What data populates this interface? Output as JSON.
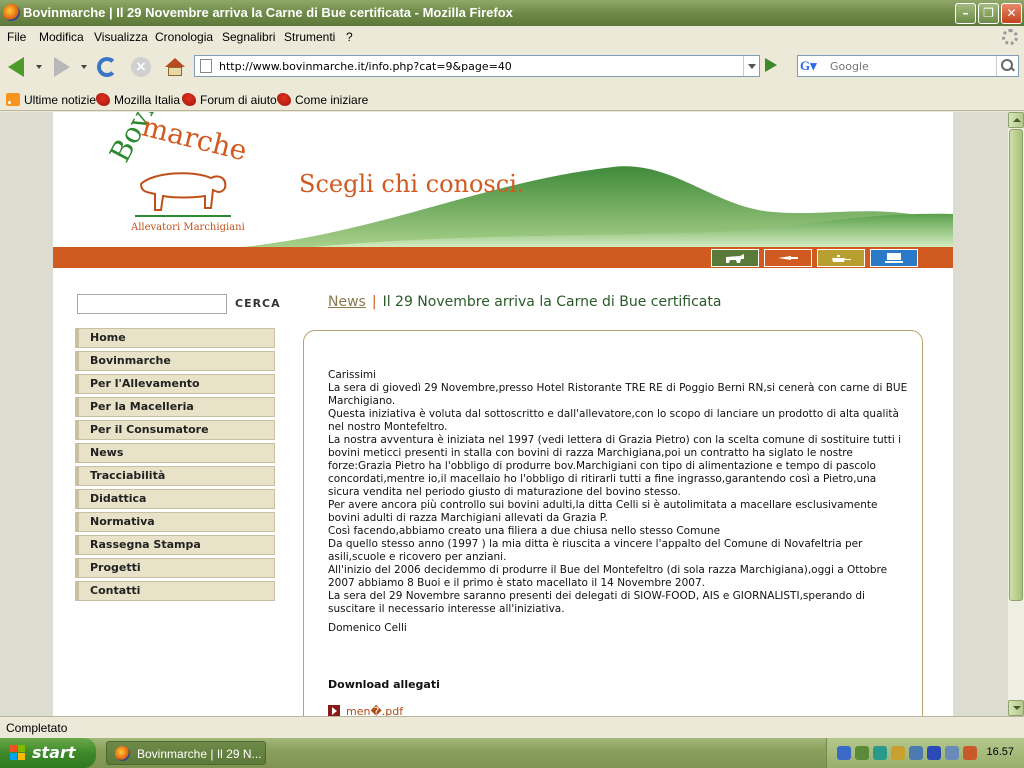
{
  "window": {
    "title": "Bovinmarche | Il 29 Novembre arriva la Carne di Bue certificata - Mozilla Firefox"
  },
  "menu": {
    "items": [
      {
        "label": "File"
      },
      {
        "label": "Modifica"
      },
      {
        "label": "Visualizza"
      },
      {
        "label": "Cronologia"
      },
      {
        "label": "Segnalibri"
      },
      {
        "label": "Strumenti"
      },
      {
        "label": "?"
      }
    ]
  },
  "toolbar": {
    "url": "http://www.bovinmarche.it/info.php?cat=9&page=40",
    "search_placeholder": "Google",
    "search_engine_icon": "google-g"
  },
  "bookmarks": [
    {
      "label": "Ultime notizie",
      "icon": "rss-icon"
    },
    {
      "label": "Mozilla Italia",
      "icon": "mozilla-icon"
    },
    {
      "label": "Forum di aiuto",
      "icon": "mozilla-icon"
    },
    {
      "label": "Come iniziare",
      "icon": "mozilla-icon"
    }
  ],
  "site": {
    "logo_bovin": "Bovin",
    "logo_marche": "marche",
    "logo_subtitle": "Allevatori Marchigiani",
    "slogan": "Scegli chi conosci.",
    "colors": {
      "orange": "#d05a20",
      "green": "#2e8a30"
    },
    "category_icons": [
      "cow-icon",
      "knife-icon",
      "pan-icon",
      "laptop-icon"
    ],
    "search_button": "CERCA",
    "nav": [
      {
        "label": "Home"
      },
      {
        "label": "Bovinmarche"
      },
      {
        "label": "Per l'Allevamento"
      },
      {
        "label": "Per la Macelleria"
      },
      {
        "label": "Per il Consumatore"
      },
      {
        "label": "News"
      },
      {
        "label": "Tracciabilità"
      },
      {
        "label": "Didattica"
      },
      {
        "label": "Normativa"
      },
      {
        "label": "Rassegna Stampa"
      },
      {
        "label": "Progetti"
      },
      {
        "label": "Contatti"
      }
    ],
    "breadcrumb": {
      "section": "News",
      "separator": "|",
      "title": "Il 29 Novembre arriva la Carne di Bue certificata"
    },
    "article": {
      "lines": [
        "Carissimi",
        "La sera di giovedì 29 Novembre,presso Hotel Ristorante TRE RE di Poggio Berni RN,si cenerà con carne di BUE Marchigiano.",
        "Questa iniziativa è voluta dal sottoscritto e dall'allevatore,con lo scopo di lanciare un prodotto di alta qualità nel nostro Montefeltro.",
        "La nostra avventura è iniziata nel 1997 (vedi lettera di Grazia Pietro) con la scelta comune di sostituire tutti i bovini meticci presenti in stalla con bovini di razza Marchigiana,poi un contratto ha siglato le nostre forze:Grazia Pietro ha l'obbligo di produrre bov.Marchigiani con tipo di alimentazione e tempo di pascolo concordati,mentre io,il macellaio ho l'obbligo di ritirarli tutti a fine ingrasso,garantendo così a Pietro,una sicura vendita nel periodo giusto di maturazione del bovino stesso.",
        "Per avere ancora più controllo sui bovini adulti,la ditta Celli si è autolimitata a macellare esclusivamente bovini adulti di razza Marchigiani allevati da Grazia P.",
        "Così facendo,abbiamo creato una filiera a due chiusa nello stesso Comune",
        "Da quello stesso anno (1997 ) la mia ditta è riuscita a vincere l'appalto del Comune di Novafeltria per asili,scuole e ricovero per anziani.",
        "All'inizio del 2006 decidemmo di produrre il Bue del Montefeltro (di sola razza Marchigiana),oggi a Ottobre 2007 abbiamo 8 Buoi e il primo è stato macellato il 14 Novembre 2007.",
        "La sera del 29 Novembre saranno presenti dei delegati di SlOW-FOOD, AIS e GIORNALISTI,sperando di suscitare il necessario interesse all'iniziativa."
      ],
      "signature": "Domenico Celli",
      "downloads_title": "Download allegati",
      "attachment": "men�.pdf"
    }
  },
  "status": {
    "text": "Completato"
  },
  "taskbar": {
    "start_label": "start",
    "task_label": "Bovinmarche | Il 29 N...",
    "clock": "16.57"
  }
}
